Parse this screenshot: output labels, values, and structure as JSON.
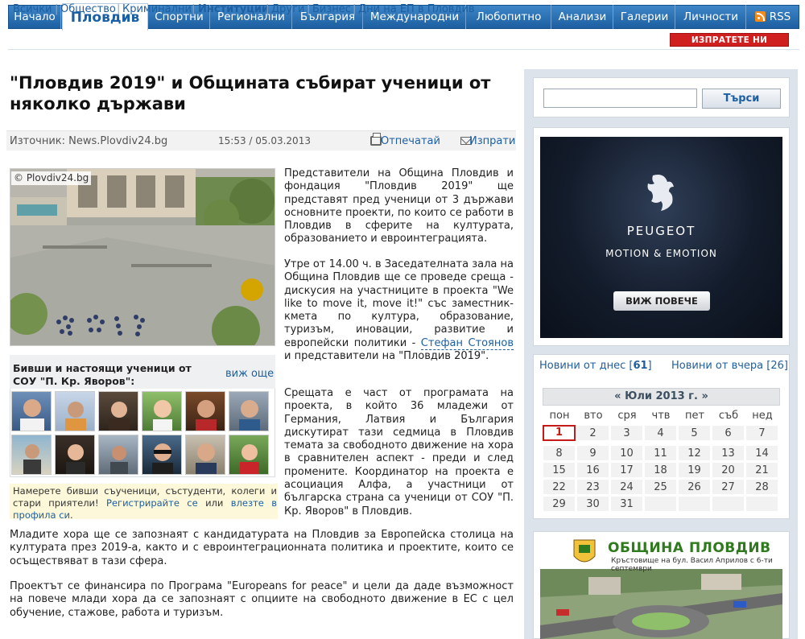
{
  "nav": {
    "items": [
      "Начало",
      "Пловдив",
      "Спортни",
      "Регионални",
      "България",
      "Международни",
      "Любопитно",
      "Анализи",
      "Галерии",
      "Личности"
    ],
    "rss": "RSS"
  },
  "subnav": {
    "items": [
      "Всички",
      "Общество",
      "Криминални",
      "Институции",
      "Други",
      "Бизнес",
      "Дни на ЕП в Пловдив"
    ],
    "send_news": "ИЗПРАТЕТЕ НИ НОВИНА"
  },
  "article": {
    "title": "\"Пловдив 2019\" и Общината събират ученици от няколко държави",
    "source": "Източник: News.Plovdiv24.bg",
    "datetime": "15:53 / 05.03.2013",
    "print_label": "Отпечатай",
    "send_label": "Изпрати",
    "photo_credit": "© Plovdiv24.bg",
    "p1": "Представители на Община Пловдив и фондация \"Пловдив 2019\" ще представят пред ученици от 3 държави основните проекти, по които се работи в Пловдив в сферите на културата, образованието и евроинтеграцията.",
    "p2_a": "Утре от 14.00 ч. в Заседателната зала на Община Пловдив ще се проведе среща - дискусия на участниците в проекта \"We like to move it, move it!\" със заместник-кмета по култура, образование, туризъм, иновации, развитие и европейски политики -",
    "p2_person": "Стефан Стоянов",
    "p2_b": "и представители на \"Пловдив 2019\".",
    "p3": "Срещата е част от програмата на проекта, в който 36 младежи от Германия, Латвия и България дискутират тази седмица в Пловдив темата за свободното движение на хора в сравнителен аспект - преди и след промените. Координатор на проекта е асоциация Алфа, а участници от българска страна са ученици от СОУ \"П. Кр. Яворов\" в Пловдив.",
    "p4": "Младите хора ще се запознаят с кандидатурата на Пловдив за Европейска столица на културата през 2019-а, както и с евроинтеграционната политика и проектите, които се осъществяват в тази сфера.",
    "p5": "Проектът се финансира по Програма \"Europeans for peace\" и цели да даде възможност на повече млади хора да се запознаят с опциите на свободното движение в ЕС с цел обучение, стажове, работа и туризъм."
  },
  "alumni": {
    "title": "Бивши и настоящи ученици от СОУ \"П. Кр. Яворов\":",
    "more": "виж още",
    "promo_a": "Намерете бивши съученици, състуденти, колеги и стари приятели!",
    "promo_register": "Регистрирайте се",
    "promo_or": "или",
    "promo_login": "влезте в профила си",
    "promo_end": "."
  },
  "sidebar": {
    "search_placeholder": "",
    "search_button": "Търси",
    "ad_brand": "PEUGEOT",
    "ad_slogan": "MOTION & EMOTION",
    "ad_button": "ВИЖ ПОВЕЧЕ",
    "news_today": "Новини от днес",
    "news_today_count": "61",
    "news_yest": "Новини от вчера",
    "news_yest_count": "26",
    "calendar": {
      "prev": "«",
      "month": "Юли 2013 г.",
      "next": "»",
      "dow": [
        "пон",
        "вто",
        "сря",
        "чтв",
        "пет",
        "съб",
        "нед"
      ],
      "days": [
        "1",
        "2",
        "3",
        "4",
        "5",
        "6",
        "7",
        "8",
        "9",
        "10",
        "11",
        "12",
        "13",
        "14",
        "15",
        "16",
        "17",
        "18",
        "19",
        "20",
        "21",
        "22",
        "23",
        "24",
        "25",
        "26",
        "27",
        "28",
        "29",
        "30",
        "31"
      ]
    },
    "banner_title": "ОБЩИНА ПЛОВДИВ",
    "banner_sub": "Кръстовище на бул. Васил Априлов с 6-ти септември"
  }
}
